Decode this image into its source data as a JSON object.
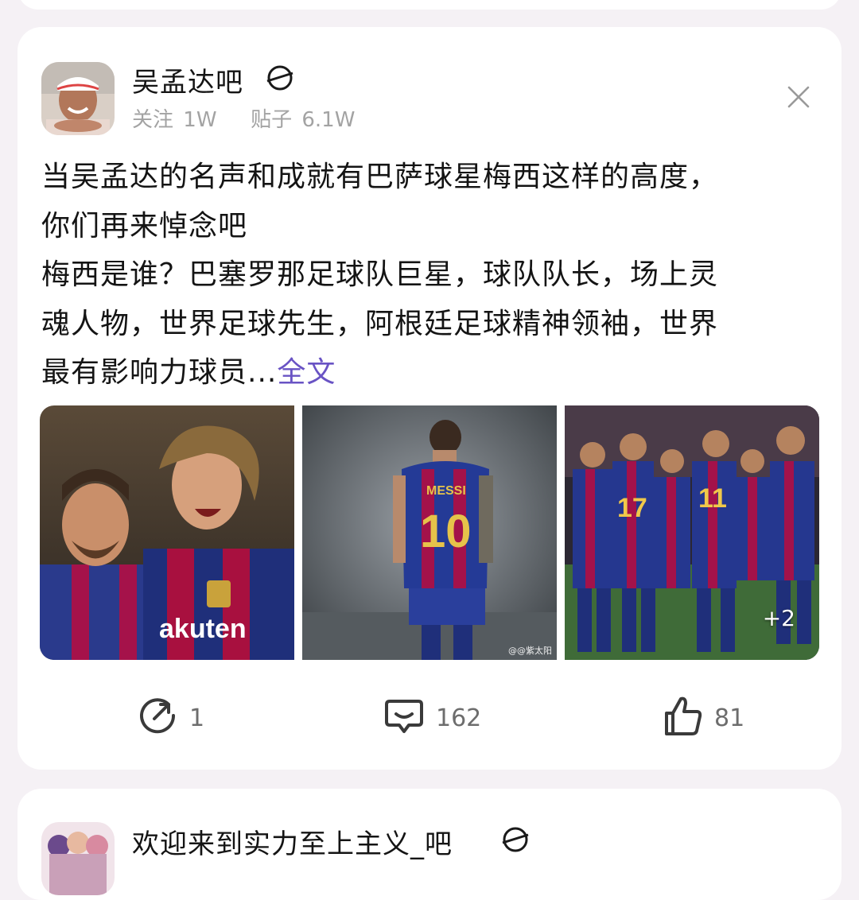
{
  "post": {
    "forum_name": "吴孟达吧",
    "follow_label": "关注",
    "follow_count": "1W",
    "posts_label": "贴子",
    "posts_count": "6.1W",
    "lines": [
      "当吴孟达的名声和成就有巴萨球星梅西这样的高度，",
      "你们再来悼念吧",
      "梅西是谁？巴塞罗那足球队巨星，球队队长，场上灵",
      "魂人物，世界足球先生，阿根廷足球精神领袖，世界"
    ],
    "last_line": "最有影响力球员...",
    "more_link": "全文",
    "images": {
      "extra_count": "+2",
      "watermark": "@@紫太阳"
    },
    "actions": {
      "share_count": "1",
      "comment_count": "162",
      "like_count": "81"
    }
  },
  "next_post": {
    "forum_name": "欢迎来到实力至上主义_吧"
  },
  "colors": {
    "accent": "#6953c4",
    "background": "#f5f1f5",
    "card": "#ffffff"
  }
}
